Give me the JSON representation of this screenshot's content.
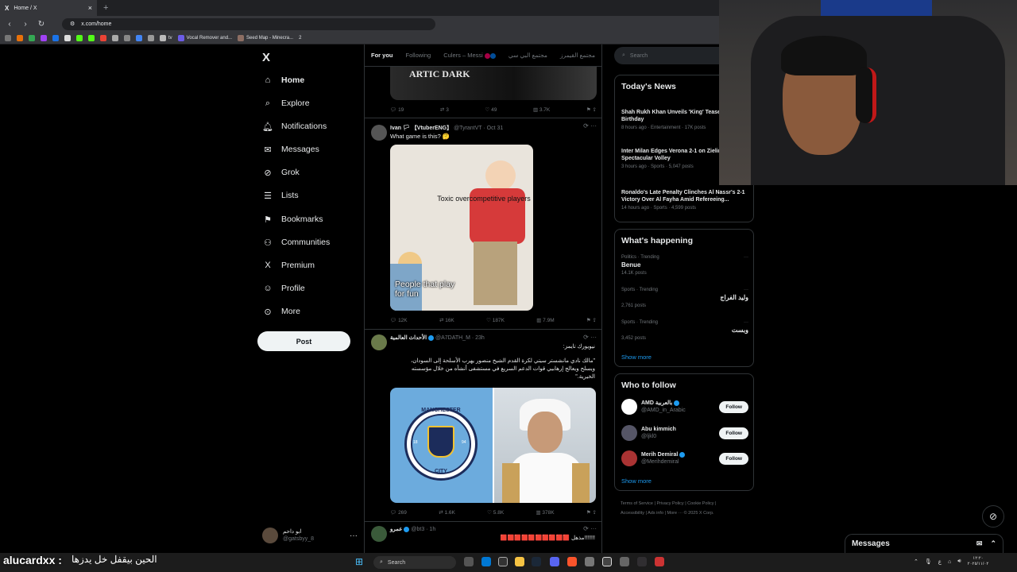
{
  "browser": {
    "tab_title": "Home / X",
    "tab_close": "×",
    "new_tab": "+",
    "url": "x.com/home",
    "bookmarks": [
      "Vocal Remover and...",
      "Seed Map - Minecra...",
      "2"
    ],
    "bookmark_tv": "tv"
  },
  "nav": {
    "logo": "X",
    "items": [
      "Home",
      "Explore",
      "Notifications",
      "Messages",
      "Grok",
      "Lists",
      "Bookmarks",
      "Communities",
      "Premium",
      "Profile",
      "More"
    ],
    "post_button": "Post",
    "profile_name": "ابو داحم",
    "profile_handle": "@gatsbyy_8",
    "profile_more": "···"
  },
  "timeline": {
    "tabs": [
      "For you",
      "Following",
      "Culers – Messi",
      "مجتمع البي سي",
      "مجتمع القيمرز"
    ],
    "post0": {
      "image_text": "ARTIC DARK",
      "actions": [
        "19",
        "3",
        "49",
        "3.7K"
      ]
    },
    "post1": {
      "name": "Ivan 🏳 【VtuberENG】",
      "handle": "@TyrantVT · Oct 31",
      "text": "What game is this? 🤔",
      "meme_top": "Toxic overcompetitive players",
      "meme_bottom": "People that play for fun",
      "actions": [
        "12K",
        "16K",
        "187K",
        "7.9M"
      ]
    },
    "post2": {
      "name": "الأحداث العالمية",
      "handle": "@A7DATH_M · 23h",
      "line1": "نيويورك تايمز:",
      "line2": "\"مالك نادي مانشستر سيتي لكرة القدم الشيخ منصور يهرب الأسلحة إلى السودان،",
      "line3": "ويسلح ويعالج إرهابيي قوات الدعم السريع في مستشفى أنشأه من خلال مؤسسته",
      "line4": "الخيرية.\"",
      "badge_top": "MANCHESTER",
      "badge_bottom": "CITY",
      "badge_left": "18",
      "badge_right": "94",
      "actions": [
        "269",
        "1.6K",
        "5.8K",
        "378K"
      ]
    },
    "post3": {
      "name": "عمرو",
      "handle": "@bt3 · 1h",
      "text": "!!!!!!!مذهل 🟥🟥🟥🟥🟥🟥🟥🟥🟥🟥"
    }
  },
  "sidebar": {
    "search_placeholder": "Search",
    "news_title": "Today's News",
    "news": [
      {
        "title": "Shah Rukh Khan Unveils 'King' Teaser on 60th Birthday",
        "meta": "8 hours ago · Entertainment · 17K posts"
      },
      {
        "title": "Inter Milan Edges Verona 2-1 on Zielinski Spectacular Volley",
        "meta": "3 hours ago · Sports · 5,047 posts"
      },
      {
        "title": "Ronaldo's Late Penalty Clinches Al Nassr's 2-1 Victory Over Al Fayha Amid Refereeing...",
        "meta": "14 hours ago · Sports · 4,599 posts"
      }
    ],
    "happening_title": "What's happening",
    "trends": [
      {
        "context": "Politics · Trending",
        "name": "Benue",
        "posts": "14.1K posts"
      },
      {
        "context": "Sports · Trending",
        "name": "وليد الفراج",
        "posts": "2,761 posts"
      },
      {
        "context": "Sports · Trending",
        "name": "وبست",
        "posts": "3,452 posts"
      }
    ],
    "show_more": "Show more",
    "follow_title": "Who to follow",
    "follows": [
      {
        "name": "AMD بالعربية",
        "handle": "@AMD_in_Arabic"
      },
      {
        "name": "Abu kimmich",
        "handle": "@ljkl0"
      },
      {
        "name": "Merih Demiral",
        "handle": "@Merihdemiral"
      }
    ],
    "follow_button": "Follow",
    "footer_line1": "Terms of Service | Privacy Policy | Cookie Policy |",
    "footer_line2": "Accessibility | Ads info | More ··· © 2025 X Corp."
  },
  "messages_drawer": {
    "title": "Messages"
  },
  "overlay": {
    "username": "alucardxx :",
    "message": "الحين بيقفل خل يدزها"
  },
  "taskbar": {
    "search": "Search",
    "time": "١٢:٢٠",
    "date": "٢٠٢٥/١١/٠٢"
  }
}
